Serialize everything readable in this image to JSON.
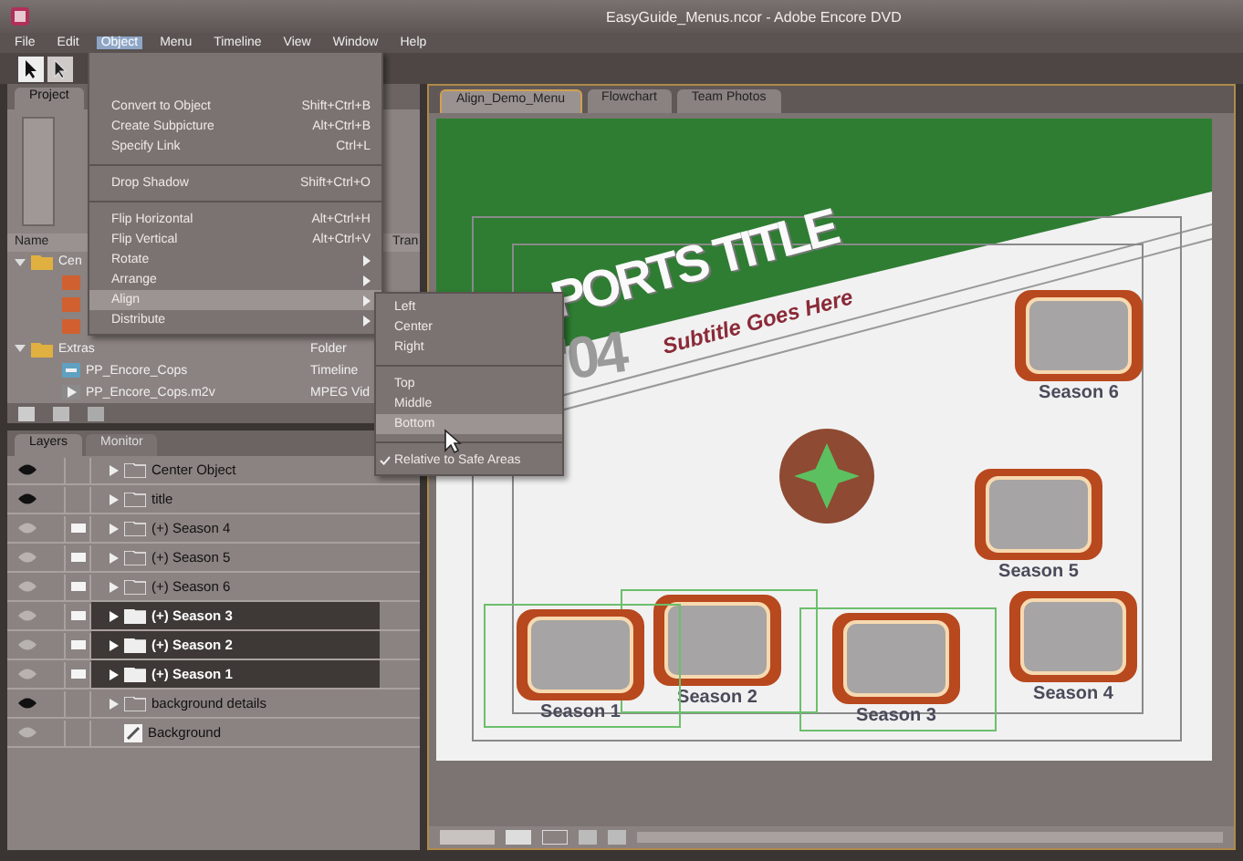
{
  "window": {
    "title": "EasyGuide_Menus.ncor - Adobe Encore DVD"
  },
  "menu_bar": [
    {
      "label": "File",
      "selected": false
    },
    {
      "label": "Edit",
      "selected": false
    },
    {
      "label": "Object",
      "selected": true
    },
    {
      "label": "Menu",
      "selected": false
    },
    {
      "label": "Timeline",
      "selected": false
    },
    {
      "label": "View",
      "selected": false
    },
    {
      "label": "Window",
      "selected": false
    },
    {
      "label": "Help",
      "selected": false
    }
  ],
  "object_menu": {
    "items": [
      {
        "kind": "item",
        "label": "Convert to Object",
        "shortcut": "Shift+Ctrl+B",
        "highlighted": false
      },
      {
        "kind": "item",
        "label": "Create Subpicture",
        "shortcut": "Alt+Ctrl+B",
        "highlighted": false
      },
      {
        "kind": "item",
        "label": "Specify Link",
        "shortcut": "Ctrl+L",
        "highlighted": false
      },
      {
        "kind": "separator"
      },
      {
        "kind": "item",
        "label": "Drop Shadow",
        "shortcut": "Shift+Ctrl+O",
        "highlighted": false
      },
      {
        "kind": "separator"
      },
      {
        "kind": "item",
        "label": "Flip Horizontal",
        "shortcut": "Alt+Ctrl+H",
        "highlighted": false
      },
      {
        "kind": "item",
        "label": "Flip Vertical",
        "shortcut": "Alt+Ctrl+V",
        "highlighted": false
      },
      {
        "kind": "submenu",
        "label": "Rotate",
        "highlighted": false
      },
      {
        "kind": "submenu",
        "label": "Arrange",
        "highlighted": false
      },
      {
        "kind": "submenu",
        "label": "Align",
        "highlighted": true
      },
      {
        "kind": "submenu",
        "label": "Distribute",
        "highlighted": false
      }
    ]
  },
  "align_submenu": {
    "items": [
      {
        "kind": "item",
        "label": "Left",
        "highlighted": false
      },
      {
        "kind": "item",
        "label": "Center",
        "highlighted": false
      },
      {
        "kind": "item",
        "label": "Right",
        "highlighted": false
      },
      {
        "kind": "separator"
      },
      {
        "kind": "item",
        "label": "Top",
        "highlighted": false
      },
      {
        "kind": "item",
        "label": "Middle",
        "highlighted": false
      },
      {
        "kind": "item",
        "label": "Bottom",
        "highlighted": true
      },
      {
        "kind": "separator"
      },
      {
        "kind": "check",
        "label": "Relative to Safe Areas",
        "checked": true,
        "highlighted": false
      }
    ]
  },
  "project_panel": {
    "tab": "Project",
    "columns": [
      "Name",
      "Tran"
    ],
    "rows": [
      {
        "kind": "folder",
        "name": "Cen",
        "expanded": true
      },
      {
        "kind": "asset"
      },
      {
        "kind": "asset"
      },
      {
        "kind": "asset"
      },
      {
        "kind": "folder",
        "name": "Extras",
        "type": "Folder",
        "expanded": true
      },
      {
        "kind": "timeline",
        "name": "PP_Encore_Cops",
        "type": "Timeline"
      },
      {
        "kind": "video",
        "name": "PP_Encore_Cops.m2v",
        "type": "MPEG Vid"
      }
    ]
  },
  "layers_panel": {
    "tabs": [
      {
        "label": "Layers",
        "selected": true
      },
      {
        "label": "Monitor",
        "selected": false
      }
    ],
    "rows": [
      {
        "kind": "folder",
        "name": "Center Object",
        "visible": true,
        "button": false,
        "selected": false
      },
      {
        "kind": "folder",
        "name": "title",
        "visible": true,
        "button": false,
        "selected": false
      },
      {
        "kind": "folder",
        "name": "(+) Season 4",
        "visible": false,
        "button": true,
        "selected": false
      },
      {
        "kind": "folder",
        "name": "(+) Season 5",
        "visible": false,
        "button": true,
        "selected": false
      },
      {
        "kind": "folder",
        "name": "(+) Season 6",
        "visible": false,
        "button": true,
        "selected": false
      },
      {
        "kind": "folder",
        "name": "(+) Season 3",
        "visible": false,
        "button": true,
        "selected": true
      },
      {
        "kind": "folder",
        "name": "(+) Season 2",
        "visible": false,
        "button": true,
        "selected": true
      },
      {
        "kind": "folder",
        "name": "(+) Season 1",
        "visible": false,
        "button": true,
        "selected": true
      },
      {
        "kind": "folder",
        "name": "background details",
        "visible": true,
        "button": false,
        "selected": false
      },
      {
        "kind": "layer",
        "name": "Background",
        "visible": false,
        "button": false,
        "selected": false
      }
    ]
  },
  "editor_tabs": [
    {
      "label": "Align_Demo_Menu",
      "selected": true
    },
    {
      "label": "Flowchart",
      "selected": false
    },
    {
      "label": "Team Photos",
      "selected": false
    }
  ],
  "menu_canvas": {
    "title": "PORTS TITLE",
    "year": "'04",
    "subtitle": "Subtitle Goes Here",
    "buttons": [
      {
        "label": "Season 6",
        "selected": false
      },
      {
        "label": "Season 5",
        "selected": false
      },
      {
        "label": "Season 4",
        "selected": false
      },
      {
        "label": "Season 3",
        "selected": true
      },
      {
        "label": "Season 2",
        "selected": true
      },
      {
        "label": "Season 1",
        "selected": true
      }
    ]
  }
}
